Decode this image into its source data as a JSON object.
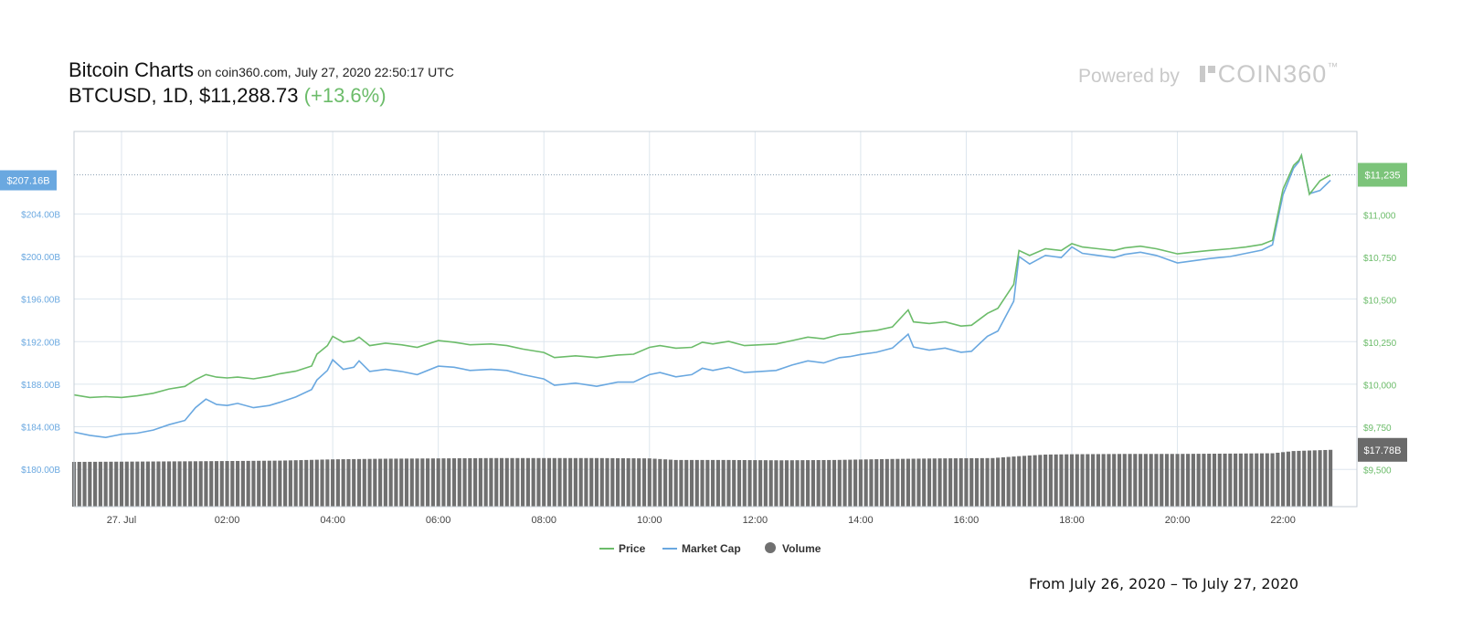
{
  "header": {
    "title": "Bitcoin Charts",
    "subtitle": "on coin360.com, July 27, 2020 22:50:17 UTC",
    "pair": "BTCUSD, 1D,",
    "price": "$11,288.73",
    "change": "(+13.6%)"
  },
  "branding": {
    "powered_by": "Powered by",
    "brand": "COIN360",
    "tm": "™"
  },
  "footer": {
    "range": "From July 26, 2020 – To July 27, 2020"
  },
  "colors": {
    "price": "#6cbc6a",
    "market_cap": "#6aa8e0",
    "volume": "#707070",
    "grid": "#dde6ee"
  },
  "chart_data": {
    "type": "line",
    "x_ticks": [
      "27. Jul",
      "02:00",
      "04:00",
      "06:00",
      "08:00",
      "10:00",
      "12:00",
      "14:00",
      "16:00",
      "18:00",
      "20:00",
      "22:00"
    ],
    "x_tick_hours": [
      0,
      2,
      4,
      6,
      8,
      10,
      12,
      14,
      16,
      18,
      20,
      22
    ],
    "x_range_hours": [
      -0.9,
      23.4
    ],
    "left_axis": {
      "label_series": "Market Cap",
      "ticks": [
        "$180.00B",
        "$184.00B",
        "$188.00B",
        "$192.00B",
        "$196.00B",
        "$200.00B",
        "$204.00B"
      ],
      "tick_values": [
        180,
        184,
        188,
        192,
        196,
        200,
        204
      ],
      "range": [
        176.5,
        211.75
      ],
      "current_label": "$207.16B",
      "current_value": 207.16
    },
    "right_axis": {
      "label_series": "Price",
      "ticks": [
        "$9,500",
        "$9,750",
        "$10,000",
        "$10,250",
        "$10,500",
        "$10,750",
        "$11,000"
      ],
      "tick_values": [
        9500,
        9750,
        10000,
        10250,
        10500,
        10750,
        11000
      ],
      "range": [
        9283,
        11490
      ],
      "current_label": "$11,235",
      "current_value": 11235
    },
    "volume": {
      "current_label": "$17.78B",
      "current_value": 17.78
    },
    "series": [
      {
        "name": "Price",
        "points": [
          [
            -0.9,
            9940
          ],
          [
            -0.6,
            9925
          ],
          [
            -0.3,
            9930
          ],
          [
            0.0,
            9925
          ],
          [
            0.3,
            9935
          ],
          [
            0.6,
            9950
          ],
          [
            0.9,
            9975
          ],
          [
            1.2,
            9990
          ],
          [
            1.4,
            10030
          ],
          [
            1.6,
            10060
          ],
          [
            1.8,
            10045
          ],
          [
            2.0,
            10040
          ],
          [
            2.2,
            10045
          ],
          [
            2.5,
            10035
          ],
          [
            2.8,
            10050
          ],
          [
            3.0,
            10065
          ],
          [
            3.3,
            10080
          ],
          [
            3.6,
            10110
          ],
          [
            3.7,
            10180
          ],
          [
            3.9,
            10230
          ],
          [
            4.0,
            10285
          ],
          [
            4.2,
            10250
          ],
          [
            4.4,
            10260
          ],
          [
            4.5,
            10280
          ],
          [
            4.7,
            10230
          ],
          [
            5.0,
            10245
          ],
          [
            5.3,
            10235
          ],
          [
            5.6,
            10220
          ],
          [
            6.0,
            10260
          ],
          [
            6.3,
            10250
          ],
          [
            6.6,
            10235
          ],
          [
            7.0,
            10240
          ],
          [
            7.3,
            10230
          ],
          [
            7.6,
            10210
          ],
          [
            8.0,
            10190
          ],
          [
            8.2,
            10160
          ],
          [
            8.6,
            10170
          ],
          [
            9.0,
            10160
          ],
          [
            9.4,
            10175
          ],
          [
            9.7,
            10180
          ],
          [
            10.0,
            10220
          ],
          [
            10.2,
            10230
          ],
          [
            10.5,
            10215
          ],
          [
            10.8,
            10220
          ],
          [
            11.0,
            10250
          ],
          [
            11.2,
            10240
          ],
          [
            11.5,
            10255
          ],
          [
            11.8,
            10230
          ],
          [
            12.1,
            10235
          ],
          [
            12.4,
            10240
          ],
          [
            12.7,
            10260
          ],
          [
            13.0,
            10280
          ],
          [
            13.3,
            10270
          ],
          [
            13.6,
            10295
          ],
          [
            13.8,
            10300
          ],
          [
            14.0,
            10310
          ],
          [
            14.3,
            10320
          ],
          [
            14.6,
            10340
          ],
          [
            14.9,
            10440
          ],
          [
            15.0,
            10370
          ],
          [
            15.3,
            10360
          ],
          [
            15.6,
            10370
          ],
          [
            15.9,
            10345
          ],
          [
            16.1,
            10350
          ],
          [
            16.4,
            10420
          ],
          [
            16.6,
            10450
          ],
          [
            16.9,
            10590
          ],
          [
            17.0,
            10790
          ],
          [
            17.2,
            10760
          ],
          [
            17.5,
            10800
          ],
          [
            17.8,
            10790
          ],
          [
            18.0,
            10830
          ],
          [
            18.2,
            10810
          ],
          [
            18.5,
            10800
          ],
          [
            18.8,
            10790
          ],
          [
            19.0,
            10805
          ],
          [
            19.3,
            10815
          ],
          [
            19.6,
            10800
          ],
          [
            20.0,
            10770
          ],
          [
            20.3,
            10780
          ],
          [
            20.6,
            10790
          ],
          [
            21.0,
            10800
          ],
          [
            21.3,
            10810
          ],
          [
            21.6,
            10825
          ],
          [
            21.8,
            10850
          ],
          [
            22.0,
            11150
          ],
          [
            22.2,
            11290
          ],
          [
            22.3,
            11320
          ],
          [
            22.35,
            11350
          ],
          [
            22.5,
            11120
          ],
          [
            22.7,
            11200
          ],
          [
            22.9,
            11235
          ]
        ]
      },
      {
        "name": "Market Cap",
        "points": [
          [
            -0.9,
            183.5
          ],
          [
            -0.6,
            183.2
          ],
          [
            -0.3,
            183.0
          ],
          [
            0.0,
            183.3
          ],
          [
            0.3,
            183.4
          ],
          [
            0.6,
            183.7
          ],
          [
            0.9,
            184.2
          ],
          [
            1.2,
            184.6
          ],
          [
            1.4,
            185.8
          ],
          [
            1.6,
            186.6
          ],
          [
            1.8,
            186.1
          ],
          [
            2.0,
            186.0
          ],
          [
            2.2,
            186.2
          ],
          [
            2.5,
            185.8
          ],
          [
            2.8,
            186.0
          ],
          [
            3.0,
            186.3
          ],
          [
            3.3,
            186.8
          ],
          [
            3.6,
            187.5
          ],
          [
            3.7,
            188.4
          ],
          [
            3.9,
            189.3
          ],
          [
            4.0,
            190.3
          ],
          [
            4.2,
            189.4
          ],
          [
            4.4,
            189.6
          ],
          [
            4.5,
            190.2
          ],
          [
            4.7,
            189.2
          ],
          [
            5.0,
            189.4
          ],
          [
            5.3,
            189.2
          ],
          [
            5.6,
            188.9
          ],
          [
            6.0,
            189.7
          ],
          [
            6.3,
            189.6
          ],
          [
            6.6,
            189.3
          ],
          [
            7.0,
            189.4
          ],
          [
            7.3,
            189.3
          ],
          [
            7.6,
            188.9
          ],
          [
            8.0,
            188.5
          ],
          [
            8.2,
            187.9
          ],
          [
            8.6,
            188.1
          ],
          [
            9.0,
            187.8
          ],
          [
            9.4,
            188.2
          ],
          [
            9.7,
            188.2
          ],
          [
            10.0,
            188.9
          ],
          [
            10.2,
            189.1
          ],
          [
            10.5,
            188.7
          ],
          [
            10.8,
            188.9
          ],
          [
            11.0,
            189.5
          ],
          [
            11.2,
            189.3
          ],
          [
            11.5,
            189.6
          ],
          [
            11.8,
            189.1
          ],
          [
            12.1,
            189.2
          ],
          [
            12.4,
            189.3
          ],
          [
            12.7,
            189.8
          ],
          [
            13.0,
            190.2
          ],
          [
            13.3,
            190.0
          ],
          [
            13.6,
            190.5
          ],
          [
            13.8,
            190.6
          ],
          [
            14.0,
            190.8
          ],
          [
            14.3,
            191.0
          ],
          [
            14.6,
            191.4
          ],
          [
            14.9,
            192.7
          ],
          [
            15.0,
            191.5
          ],
          [
            15.3,
            191.2
          ],
          [
            15.6,
            191.4
          ],
          [
            15.9,
            191.0
          ],
          [
            16.1,
            191.1
          ],
          [
            16.4,
            192.5
          ],
          [
            16.6,
            193.0
          ],
          [
            16.9,
            195.8
          ],
          [
            17.0,
            200.0
          ],
          [
            17.2,
            199.3
          ],
          [
            17.5,
            200.1
          ],
          [
            17.8,
            199.9
          ],
          [
            18.0,
            200.9
          ],
          [
            18.2,
            200.3
          ],
          [
            18.5,
            200.1
          ],
          [
            18.8,
            199.9
          ],
          [
            19.0,
            200.2
          ],
          [
            19.3,
            200.4
          ],
          [
            19.6,
            200.1
          ],
          [
            20.0,
            199.4
          ],
          [
            20.3,
            199.6
          ],
          [
            20.6,
            199.8
          ],
          [
            21.0,
            200.0
          ],
          [
            21.3,
            200.3
          ],
          [
            21.6,
            200.6
          ],
          [
            21.8,
            201.1
          ],
          [
            22.0,
            205.8
          ],
          [
            22.2,
            208.3
          ],
          [
            22.3,
            208.9
          ],
          [
            22.35,
            209.5
          ],
          [
            22.5,
            205.9
          ],
          [
            22.7,
            206.2
          ],
          [
            22.9,
            207.16
          ]
        ]
      },
      {
        "name": "Volume",
        "unit": "B USD",
        "points": [
          [
            -0.9,
            14.0
          ],
          [
            1.4,
            14.2
          ],
          [
            3.0,
            14.4
          ],
          [
            4.0,
            14.8
          ],
          [
            5.0,
            15.0
          ],
          [
            6.0,
            15.1
          ],
          [
            7.0,
            15.2
          ],
          [
            8.0,
            15.2
          ],
          [
            9.0,
            15.2
          ],
          [
            10.0,
            15.1
          ],
          [
            10.5,
            14.6
          ],
          [
            11.5,
            14.6
          ],
          [
            12.5,
            14.5
          ],
          [
            13.5,
            14.6
          ],
          [
            14.5,
            14.9
          ],
          [
            15.5,
            15.1
          ],
          [
            16.5,
            15.2
          ],
          [
            17.0,
            15.8
          ],
          [
            17.5,
            16.3
          ],
          [
            18.0,
            16.4
          ],
          [
            19.0,
            16.5
          ],
          [
            20.0,
            16.5
          ],
          [
            21.0,
            16.6
          ],
          [
            21.8,
            16.7
          ],
          [
            22.2,
            17.4
          ],
          [
            22.9,
            17.78
          ]
        ]
      }
    ],
    "legend": [
      {
        "name": "Price",
        "marker": "line"
      },
      {
        "name": "Market Cap",
        "marker": "line"
      },
      {
        "name": "Volume",
        "marker": "circle"
      }
    ],
    "legend_position": "bottom-center",
    "grid": true
  }
}
